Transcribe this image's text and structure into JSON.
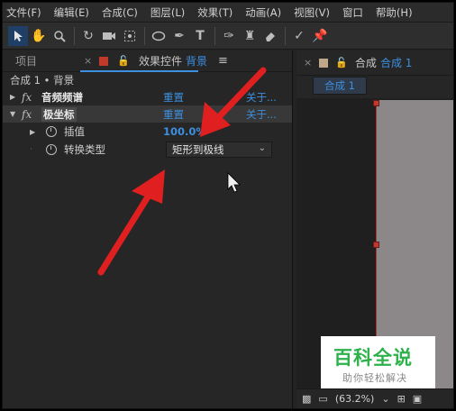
{
  "menu": [
    "文件(F)",
    "编辑(E)",
    "合成(C)",
    "图层(L)",
    "效果(T)",
    "动画(A)",
    "视图(V)",
    "窗口",
    "帮助(H)"
  ],
  "toolbar_icons": [
    "selection-tool-icon",
    "hand-tool-icon",
    "zoom-tool-icon",
    "rotate-tool-icon",
    "camera-tool-icon",
    "pan-behind-tool-icon",
    "ellipse-tool-icon",
    "pen-tool-icon",
    "type-tool-icon",
    "brush-tool-icon",
    "clone-stamp-tool-icon",
    "eraser-tool-icon",
    "roto-brush-tool-icon",
    "puppet-pin-tool-icon"
  ],
  "left_panel": {
    "tab_project": "项目",
    "tab_effects": "效果控件",
    "tab_layer": "背景",
    "breadcrumb": "合成 1 • 背景",
    "effects": [
      {
        "name": "音频频谱",
        "reset": "重置",
        "about": "关于..."
      },
      {
        "name": "极坐标",
        "reset": "重置",
        "about": "关于..."
      }
    ],
    "properties": [
      {
        "name": "插值",
        "value": "100.0",
        "unit": "%"
      },
      {
        "name": "转换类型",
        "value": "矩形到极线"
      }
    ]
  },
  "right_panel": {
    "tab_comp_label": "合成",
    "tab_comp_name": "合成 1",
    "subtab": "合成 1",
    "zoom": "(63.2%)"
  },
  "watermark": {
    "title": "百科全说",
    "subtitle": "助你轻松解决"
  },
  "colors": {
    "accent_blue": "#3d8fe0",
    "arrow_red": "#e02020",
    "label_red": "#c0392b",
    "watermark_green": "#2db14b"
  }
}
